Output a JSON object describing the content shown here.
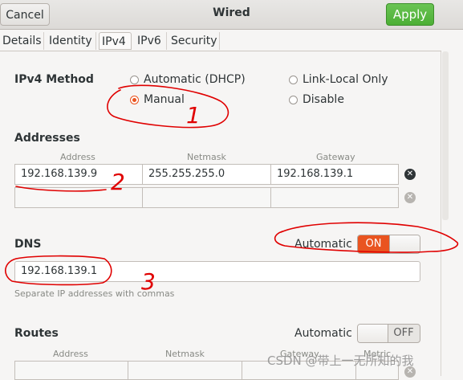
{
  "header": {
    "title": "Wired",
    "cancel_label": "Cancel",
    "apply_label": "Apply"
  },
  "tabs": [
    {
      "label": "Details"
    },
    {
      "label": "Identity"
    },
    {
      "label": "IPv4",
      "active": true
    },
    {
      "label": "IPv6"
    },
    {
      "label": "Security"
    }
  ],
  "ipv4_method": {
    "label": "IPv4 Method",
    "options": [
      {
        "label": "Automatic (DHCP)",
        "checked": false
      },
      {
        "label": "Manual",
        "checked": true
      },
      {
        "label": "Link-Local Only",
        "checked": false
      },
      {
        "label": "Disable",
        "checked": false
      }
    ]
  },
  "addresses": {
    "title": "Addresses",
    "columns": [
      "Address",
      "Netmask",
      "Gateway"
    ],
    "rows": [
      {
        "address": "192.168.139.9",
        "netmask": "255.255.255.0",
        "gateway": "192.168.139.1"
      },
      {
        "address": "",
        "netmask": "",
        "gateway": ""
      }
    ]
  },
  "dns": {
    "title": "DNS",
    "automatic_label": "Automatic",
    "switch_state": "ON",
    "value": "192.168.139.1",
    "hint": "Separate IP addresses with commas"
  },
  "routes": {
    "title": "Routes",
    "automatic_label": "Automatic",
    "switch_state": "OFF",
    "columns": [
      "Address",
      "Netmask",
      "Gateway",
      "Metric"
    ]
  },
  "annotations": [
    "1",
    "2",
    "3"
  ],
  "watermark": "CSDN @带上一无所知的我",
  "colors": {
    "accent": "#e95420",
    "apply_green": "#4caf35",
    "annotation_red": "#e00000"
  }
}
